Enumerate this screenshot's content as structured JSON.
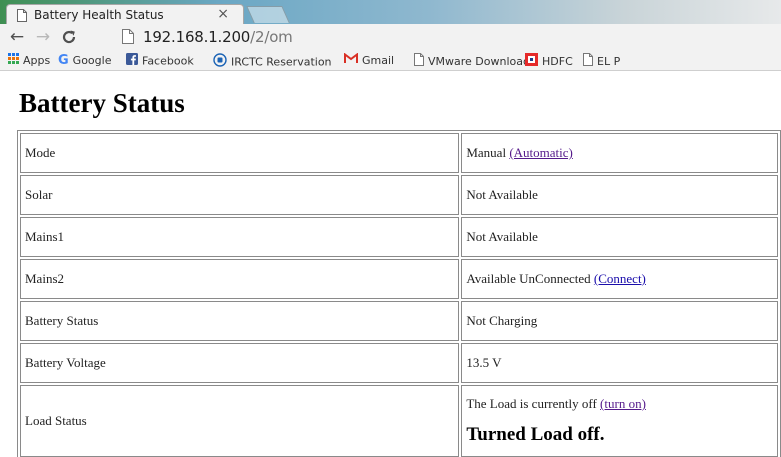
{
  "browser": {
    "tab": {
      "title": "Battery Health Status",
      "close": "×"
    },
    "url": {
      "host": "192.168.1.200",
      "path": "/2/om"
    },
    "nav": {
      "back": "←",
      "forward": "→",
      "reload": "C"
    },
    "bookmarks": [
      {
        "label": "Apps",
        "icon": "apps-grid-icon",
        "color": "#e8710a"
      },
      {
        "label": "Google",
        "icon": "google-icon",
        "color": "#4285f4"
      },
      {
        "label": "Facebook",
        "icon": "facebook-icon",
        "color": "#3b5998"
      },
      {
        "label": "IRCTC Reservation",
        "icon": "irctc-icon",
        "color": "#1b63b5"
      },
      {
        "label": "Gmail",
        "icon": "gmail-icon",
        "color": "#d93025"
      },
      {
        "label": "VMware Download",
        "icon": "page-icon",
        "color": "#777777"
      },
      {
        "label": "HDFC",
        "icon": "hdfc-icon",
        "color": "#e52a2a"
      },
      {
        "label": "EL P",
        "icon": "page-icon",
        "color": "#777777"
      }
    ]
  },
  "page": {
    "title": "Battery Status",
    "rows": [
      {
        "label": "Mode",
        "value": "Manual",
        "link": "(Automatic)"
      },
      {
        "label": "Solar",
        "value": "Not Available"
      },
      {
        "label": "Mains1",
        "value": "Not Available"
      },
      {
        "label": "Mains2",
        "value": "Available UnConnected",
        "link": "(Connect)"
      },
      {
        "label": "Battery Status",
        "value": "Not Charging"
      },
      {
        "label": "Battery Voltage",
        "value": "13.5 V"
      },
      {
        "label": "Load Status",
        "value": "The Load is currently off",
        "link": "(turn on)",
        "message": "Turned Load off."
      }
    ]
  }
}
